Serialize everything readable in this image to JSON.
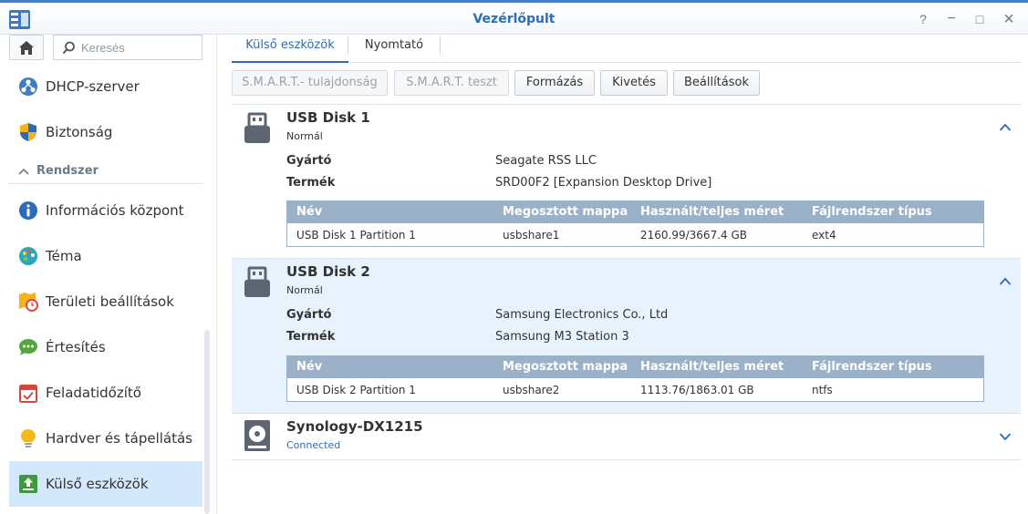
{
  "window": {
    "title": "Vezérlőpult",
    "help_label": "?",
    "minimize_label": "−",
    "maximize_label": "□",
    "close_label": "×"
  },
  "sidebar": {
    "search": {
      "placeholder": "Keresés",
      "value": ""
    },
    "items": [
      {
        "label": "DHCP-szerver"
      },
      {
        "label": "Biztonság"
      }
    ],
    "section": {
      "label": "Rendszer"
    },
    "system_items": [
      {
        "label": "Információs központ"
      },
      {
        "label": "Téma"
      },
      {
        "label": "Területi beállítások"
      },
      {
        "label": "Értesítés"
      },
      {
        "label": "Feladatidőzítő"
      },
      {
        "label": "Hardver és tápellátás"
      },
      {
        "label": "Külső eszközök",
        "active": true
      }
    ]
  },
  "tabs": [
    {
      "label": "Külső eszközök",
      "active": true
    },
    {
      "label": "Nyomtató"
    }
  ],
  "toolbar": {
    "smart_props": "S.M.A.R.T.- tulajdonság",
    "smart_test": "S.M.A.R.T. teszt",
    "format": "Formázás",
    "eject": "Kivetés",
    "settings": "Beállítások"
  },
  "devices": [
    {
      "name": "USB Disk 1",
      "status": "Normál",
      "manufacturer_label": "Gyártó",
      "manufacturer": "Seagate RSS LLC",
      "product_label": "Termék",
      "product": "SRD00F2 [Expansion Desktop Drive]",
      "columns": [
        "Név",
        "Megosztott mappa",
        "Használt/teljes méret",
        "Fájlrendszer típus"
      ],
      "partition": {
        "name": "USB Disk 1 Partition 1",
        "share": "usbshare1",
        "size": "2160.99/3667.4 GB",
        "fs": "ext4"
      },
      "expanded": true
    },
    {
      "name": "USB Disk 2",
      "status": "Normál",
      "manufacturer_label": "Gyártó",
      "manufacturer": "Samsung Electronics Co., Ltd",
      "product_label": "Termék",
      "product": "Samsung M3 Station 3",
      "columns": [
        "Név",
        "Megosztott mappa",
        "Használt/teljes méret",
        "Fájlrendszer típus"
      ],
      "partition": {
        "name": "USB Disk 2 Partition 1",
        "share": "usbshare2",
        "size": "1113.76/1863.01 GB",
        "fs": "ntfs"
      },
      "expanded": true,
      "selected": true
    },
    {
      "name": "Synology-DX1215",
      "status": "Connected",
      "expanded": false
    }
  ],
  "colors": {
    "accent": "#2e6db4",
    "selected_row": "#e7f2fc",
    "table_header": "#9ab1c8",
    "active_nav": "#d4e8fb"
  },
  "icons": {
    "app": "control-panel-icon",
    "home": "home-icon",
    "search": "search-icon",
    "usb": "usb-drive-icon",
    "expansion": "expansion-unit-icon"
  }
}
